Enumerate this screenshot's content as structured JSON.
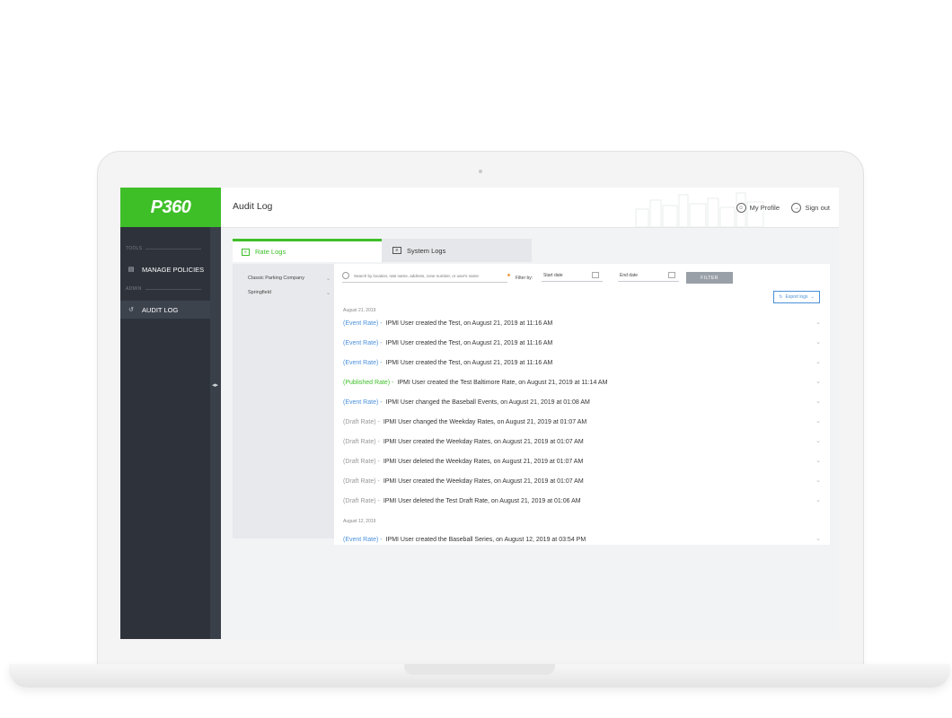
{
  "app": {
    "logo_text": "P360",
    "page_title": "Audit Log",
    "brand_color": "#3ebf28"
  },
  "topbar": {
    "my_profile": "My Profile",
    "sign_out": "Sign out"
  },
  "sidebar": {
    "section_tools": "TOOLS",
    "section_admin": "ADMIN",
    "items": [
      {
        "label": "MANAGE POLICIES",
        "icon": "document-icon"
      },
      {
        "label": "AUDIT LOG",
        "icon": "history-icon"
      }
    ]
  },
  "tabs": [
    {
      "label": "Rate Logs",
      "icon": "rate-log-icon",
      "active": true
    },
    {
      "label": "System Logs",
      "icon": "system-log-icon",
      "active": false
    }
  ],
  "companies": [
    {
      "name": "Classic Parking Company"
    },
    {
      "name": "Springfield"
    }
  ],
  "filters": {
    "search_placeholder": "Search by location, rate name, address, zone number, or user's name",
    "filter_by": "Filter by:",
    "start_date": "Start date",
    "end_date": "End date",
    "filter_button": "FILTER",
    "export_button": "Export logs"
  },
  "log_groups": [
    {
      "date": "August 21, 2019",
      "entries": [
        {
          "type": "(Event Rate) -",
          "kind": "event",
          "text": "IPMI User created the Test, on August 21, 2019 at 11:16 AM"
        },
        {
          "type": "(Event Rate) -",
          "kind": "event",
          "text": "IPMI User created the Test, on August 21, 2019 at 11:16 AM"
        },
        {
          "type": "(Event Rate) -",
          "kind": "event",
          "text": "IPMI User created the Test, on August 21, 2019 at 11:16 AM"
        },
        {
          "type": "(Published Rate) -",
          "kind": "published",
          "text": "IPMI User created the Test Baltimore Rate, on August 21, 2019 at 11:14 AM"
        },
        {
          "type": "(Event Rate) -",
          "kind": "event",
          "text": "IPMI User changed the Baseball Events, on August 21, 2019 at 01:08 AM"
        },
        {
          "type": "(Draft Rate) -",
          "kind": "draft",
          "text": "IPMI User changed the Weekday Rates, on August 21, 2019 at 01:07 AM"
        },
        {
          "type": "(Draft Rate) -",
          "kind": "draft",
          "text": "IPMI User created the Weekday Rates, on August 21, 2019 at 01:07 AM"
        },
        {
          "type": "(Draft Rate) -",
          "kind": "draft",
          "text": "IPMI User deleted the Weekday Rates, on August 21, 2019 at 01:07 AM"
        },
        {
          "type": "(Draft Rate) -",
          "kind": "draft",
          "text": "IPMI User created the Weekday Rates, on August 21, 2019 at 01:07 AM"
        },
        {
          "type": "(Draft Rate) -",
          "kind": "draft",
          "text": "IPMI User deleted the Test Draft Rate, on August 21, 2019 at 01:06 AM"
        }
      ]
    },
    {
      "date": "August 12, 2019",
      "entries": [
        {
          "type": "(Event Rate) -",
          "kind": "event",
          "text": "IPMI User created the Baseball Series, on August 12, 2019 at 03:54 PM"
        }
      ]
    }
  ]
}
